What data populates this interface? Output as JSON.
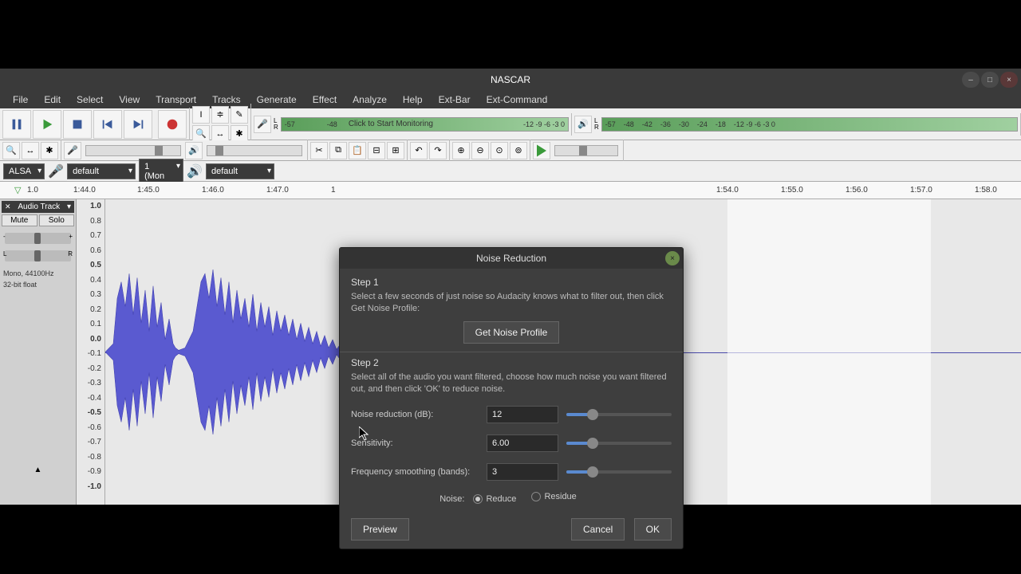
{
  "title": "NASCAR",
  "menu": [
    "File",
    "Edit",
    "Select",
    "View",
    "Transport",
    "Tracks",
    "Generate",
    "Effect",
    "Analyze",
    "Help",
    "Ext-Bar",
    "Ext-Command"
  ],
  "rec_meter": {
    "label_left": "L\nR",
    "text": "Click to Start Monitoring",
    "ticks": [
      "-57",
      "-48",
      "",
      "-12 -9 -6 -3 0"
    ]
  },
  "play_meter": {
    "ticks": [
      "-57",
      "-48",
      "-42",
      "-36",
      "-30",
      "-24",
      "-18",
      "-12 -9 -6 -3 0"
    ]
  },
  "device": {
    "host": "ALSA",
    "in": "default",
    "inch": "1 (Mon",
    "out": "default"
  },
  "timeline": [
    "1.0",
    "1:44.0",
    "1:45.0",
    "1:46.0",
    "1:47.0",
    "1",
    "1:54.0",
    "1:55.0",
    "1:56.0",
    "1:57.0",
    "1:58.0"
  ],
  "timeline_pos": [
    34,
    92,
    172,
    253,
    334,
    415,
    898,
    979,
    1060,
    1141,
    1222
  ],
  "track": {
    "title": "Audio Track",
    "mute": "Mute",
    "solo": "Solo",
    "info1": "Mono, 44100Hz",
    "info2": "32-bit float"
  },
  "ruler": [
    "1.0",
    "0.8",
    "0.7",
    "0.6",
    "0.5",
    "0.4",
    "0.3",
    "0.2",
    "0.1",
    "0.0",
    "-0.1",
    "-0.2",
    "-0.3",
    "-0.4",
    "-0.5",
    "-0.6",
    "-0.7",
    "-0.8",
    "-0.9",
    "-1.0"
  ],
  "dialog": {
    "title": "Noise Reduction",
    "step1": "Step 1",
    "step1_desc": "Select a few seconds of just noise so Audacity knows what to filter out, then click Get Noise Profile:",
    "get_profile": "Get Noise Profile",
    "step2": "Step 2",
    "step2_desc": "Select all of the audio you want filtered, choose how much noise you want filtered out, and then click 'OK' to reduce noise.",
    "nr_label": "Noise reduction (dB):",
    "nr_value": "12",
    "sens_label": "Sensitivity:",
    "sens_value": "6.00",
    "fs_label": "Frequency smoothing (bands):",
    "fs_value": "3",
    "noise_label": "Noise:",
    "reduce": "Reduce",
    "residue": "Residue",
    "preview": "Preview",
    "cancel": "Cancel",
    "ok": "OK"
  }
}
